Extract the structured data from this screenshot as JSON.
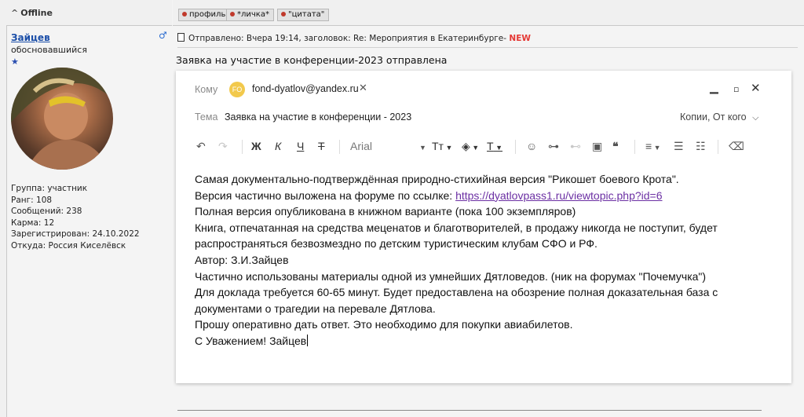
{
  "status": {
    "label": "Offline"
  },
  "post_buttons": [
    {
      "label": "профиль"
    },
    {
      "label": "*личка*"
    },
    {
      "label": "\"цитата\""
    }
  ],
  "author": {
    "name": "Зайцев",
    "title": "обосновавшийся",
    "stars": "★",
    "info": [
      "Группа: участник",
      "Ранг: 108",
      "Сообщений: 238",
      "Карма: 12",
      "Зарегистрирован: 24.10.2022",
      "Откуда: Россия Киселёвск"
    ]
  },
  "post": {
    "header": "Отправлено: Вчера 19:14, заголовок: Re: Мероприятия в Екатеринбурге-",
    "new_badge": "NEW",
    "title": "Заявка на участие в конференции-2023 отправлена"
  },
  "mail": {
    "to_label": "Кому",
    "recipient_initials": "FO",
    "recipient": "fond-dyatlov@yandex.ru",
    "subject_label": "Тема",
    "subject": "Заявка на участие в конференции - 2023",
    "cc_label": "Копии, От кого",
    "toolbar": {
      "bold": "Ж",
      "italic": "К",
      "underline": "Ч",
      "strike": "Т",
      "font": "Arial",
      "text_size": "Тт",
      "text_color": "Т"
    },
    "body": {
      "line1": "Самая документально-подтверждённая природно-стихийная версия \"Рикошет боевого Крота\".",
      "line2_prefix": "Версия частично выложена на форуме по ссылке: ",
      "link": "https://dyatlovpass1.ru/viewtopic.php?id=6",
      "line3": "Полная версия опубликована в книжном варианте (пока 100 экземпляров)",
      "line4": "Книга, отпечатанная на средства меценатов и благотворителей, в продажу никогда не поступит, будет",
      "line5": "распространяться безвозмездно по детским туристическим клубам СФО и РФ.",
      "line6": "Автор: З.И.Зайцев",
      "line7": "Частично использованы материалы одной из умнейших Дятловедов. (ник на форумах \"Почемучка\")",
      "line8": "Для доклада требуется 60-65 минут. Будет предоставлена на обозрение полная доказательная база с",
      "line9": "документами о трагедии на перевале Дятлова.",
      "line10": "Прошу оперативно дать ответ. Это необходимо для покупки авиабилетов.",
      "line11": "С Уважением! Зайцев"
    }
  }
}
